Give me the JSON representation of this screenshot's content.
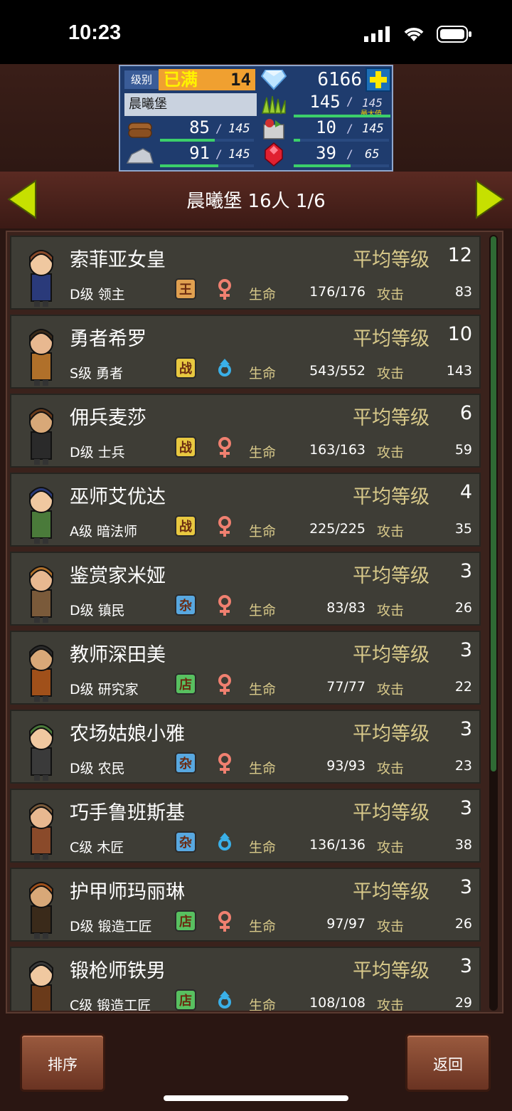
{
  "status_bar": {
    "time": "10:23"
  },
  "hud": {
    "level_label": "级别",
    "level_status": "已满",
    "level_value": "14",
    "gems": "6166",
    "town_name": "晨曦堡",
    "food": "145",
    "food_max": "145",
    "food_max_label": "最大值",
    "wood": "85",
    "wood_max": "145",
    "goods": "10",
    "goods_max": "145",
    "ore": "91",
    "ore_max": "145",
    "ruby": "39",
    "ruby_max": "65"
  },
  "nav": {
    "title": "晨曦堡  16人 1/6"
  },
  "residents": [
    {
      "name": "索菲亚女皇",
      "avg_label": "平均等级",
      "avg": "12",
      "cls": "D级 领主",
      "badge": "王",
      "badge_color": "#e0a050",
      "gender": "female",
      "hp_label": "生命",
      "hp": "176/176",
      "atk_label": "攻击",
      "atk": "83"
    },
    {
      "name": "勇者希罗",
      "avg_label": "平均等级",
      "avg": "10",
      "cls": "S级 勇者",
      "badge": "战",
      "badge_color": "#e8c840",
      "gender": "male",
      "hp_label": "生命",
      "hp": "543/552",
      "atk_label": "攻击",
      "atk": "143"
    },
    {
      "name": "佣兵麦莎",
      "avg_label": "平均等级",
      "avg": "6",
      "cls": "D级 士兵",
      "badge": "战",
      "badge_color": "#e8c840",
      "gender": "female",
      "hp_label": "生命",
      "hp": "163/163",
      "atk_label": "攻击",
      "atk": "59"
    },
    {
      "name": "巫师艾优达",
      "avg_label": "平均等级",
      "avg": "4",
      "cls": "A级 暗法师",
      "badge": "战",
      "badge_color": "#e8c840",
      "gender": "female",
      "hp_label": "生命",
      "hp": "225/225",
      "atk_label": "攻击",
      "atk": "35"
    },
    {
      "name": "鉴赏家米娅",
      "avg_label": "平均等级",
      "avg": "3",
      "cls": "D级 镇民",
      "badge": "杂",
      "badge_color": "#58a8e0",
      "gender": "female",
      "hp_label": "生命",
      "hp": "83/83",
      "atk_label": "攻击",
      "atk": "26"
    },
    {
      "name": "教师深田美",
      "avg_label": "平均等级",
      "avg": "3",
      "cls": "D级 研究家",
      "badge": "店",
      "badge_color": "#58c060",
      "gender": "female",
      "hp_label": "生命",
      "hp": "77/77",
      "atk_label": "攻击",
      "atk": "22"
    },
    {
      "name": "农场姑娘小雅",
      "avg_label": "平均等级",
      "avg": "3",
      "cls": "D级 农民",
      "badge": "杂",
      "badge_color": "#58a8e0",
      "gender": "female",
      "hp_label": "生命",
      "hp": "93/93",
      "atk_label": "攻击",
      "atk": "23"
    },
    {
      "name": "巧手鲁班斯基",
      "avg_label": "平均等级",
      "avg": "3",
      "cls": "C级 木匠",
      "badge": "杂",
      "badge_color": "#58a8e0",
      "gender": "male",
      "hp_label": "生命",
      "hp": "136/136",
      "atk_label": "攻击",
      "atk": "38"
    },
    {
      "name": "护甲师玛丽琳",
      "avg_label": "平均等级",
      "avg": "3",
      "cls": "D级 锻造工匠",
      "badge": "店",
      "badge_color": "#58c060",
      "gender": "female",
      "hp_label": "生命",
      "hp": "97/97",
      "atk_label": "攻击",
      "atk": "26"
    },
    {
      "name": "锻枪师铁男",
      "avg_label": "平均等级",
      "avg": "3",
      "cls": "C级 锻造工匠",
      "badge": "店",
      "badge_color": "#58c060",
      "gender": "male",
      "hp_label": "生命",
      "hp": "108/108",
      "atk_label": "攻击",
      "atk": "29"
    }
  ],
  "buttons": {
    "sort": "排序",
    "back": "返回"
  },
  "colors": {
    "accent_label": "#d8c98a",
    "row_bg": "#3e3d36",
    "hud_bg": "#1f3c6e"
  }
}
